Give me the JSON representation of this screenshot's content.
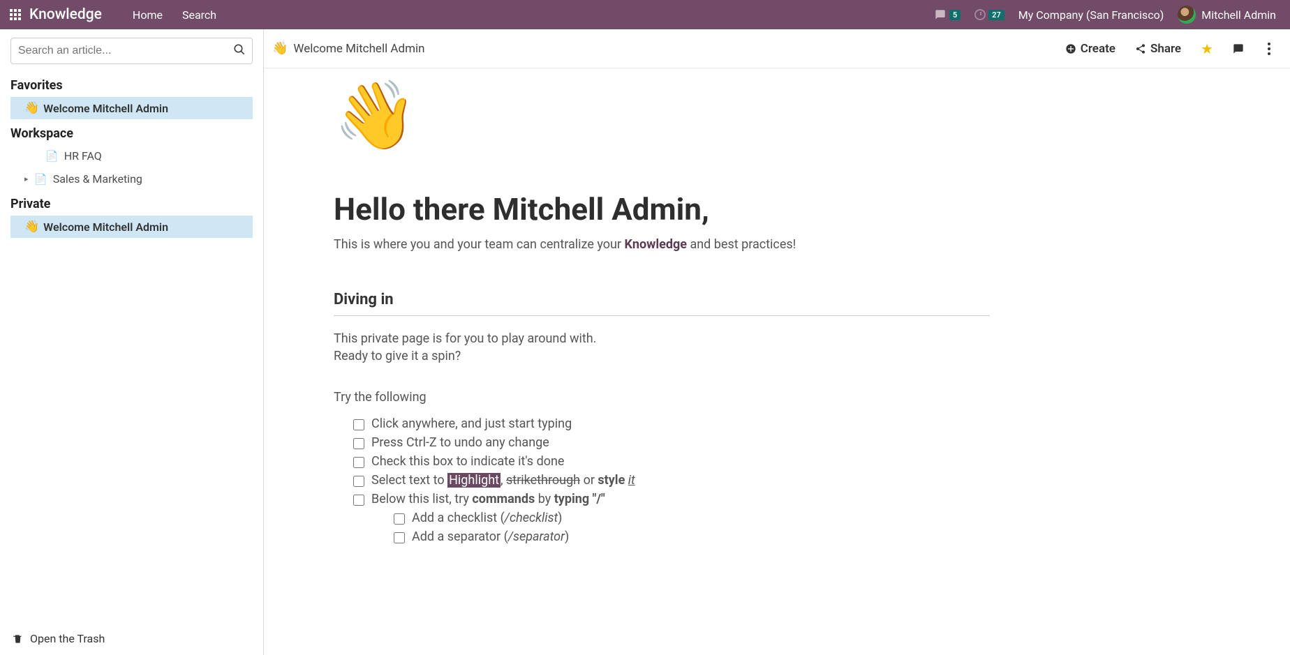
{
  "navbar": {
    "brand": "Knowledge",
    "links": {
      "home": "Home",
      "search": "Search"
    },
    "messages_badge": "5",
    "activities_badge": "27",
    "company": "My Company (San Francisco)",
    "username": "Mitchell Admin"
  },
  "sidebar": {
    "search_placeholder": "Search an article...",
    "sections": {
      "favorites": {
        "label": "Favorites",
        "items": [
          {
            "emoji": "👋",
            "label": "Welcome Mitchell Admin",
            "selected": true
          }
        ]
      },
      "workspace": {
        "label": "Workspace",
        "items": [
          {
            "icon": "doc",
            "label": "HR FAQ",
            "has_children": false
          },
          {
            "icon": "doc",
            "label": "Sales & Marketing",
            "has_children": true
          }
        ]
      },
      "private": {
        "label": "Private",
        "items": [
          {
            "emoji": "👋",
            "label": "Welcome Mitchell Admin",
            "selected": true
          }
        ]
      }
    },
    "trash": "Open the Trash"
  },
  "toolbar": {
    "breadcrumb_emoji": "👋",
    "breadcrumb_title": "Welcome Mitchell Admin",
    "create": "Create",
    "share": "Share"
  },
  "doc": {
    "cover_emoji": "👋",
    "title": "Hello there Mitchell Admin,",
    "subtitle_pre": "This is where you and your team can centralize your ",
    "subtitle_bold": "Knowledge",
    "subtitle_post": " and best practices!",
    "h2": "Diving in",
    "p1": "This private page is for you to play around with.",
    "p2": "Ready to give it a spin?",
    "p3": "Try the following",
    "checklist": {
      "i0": "Click anywhere, and just start typing",
      "i1": "Press Ctrl-Z to undo any change",
      "i2": "Check this box to indicate it's done",
      "i3_pre": "Select text to ",
      "i3_hl": "Highlight",
      "i3_mid1": ", ",
      "i3_strike": "strikethrough",
      "i3_mid2": " or ",
      "i3_style": "style",
      "i3_space": " ",
      "i3_it": "it",
      "i4_pre": "Below this list, try ",
      "i4_b1": "commands",
      "i4_mid": " by ",
      "i4_b2": "typing \"/\"",
      "nested": {
        "n0_pre": "Add a checklist (",
        "n0_em": "/checklist",
        "n0_post": ")",
        "n1_pre": "Add a separator (",
        "n1_em": "/separator",
        "n1_post": ")"
      }
    }
  }
}
